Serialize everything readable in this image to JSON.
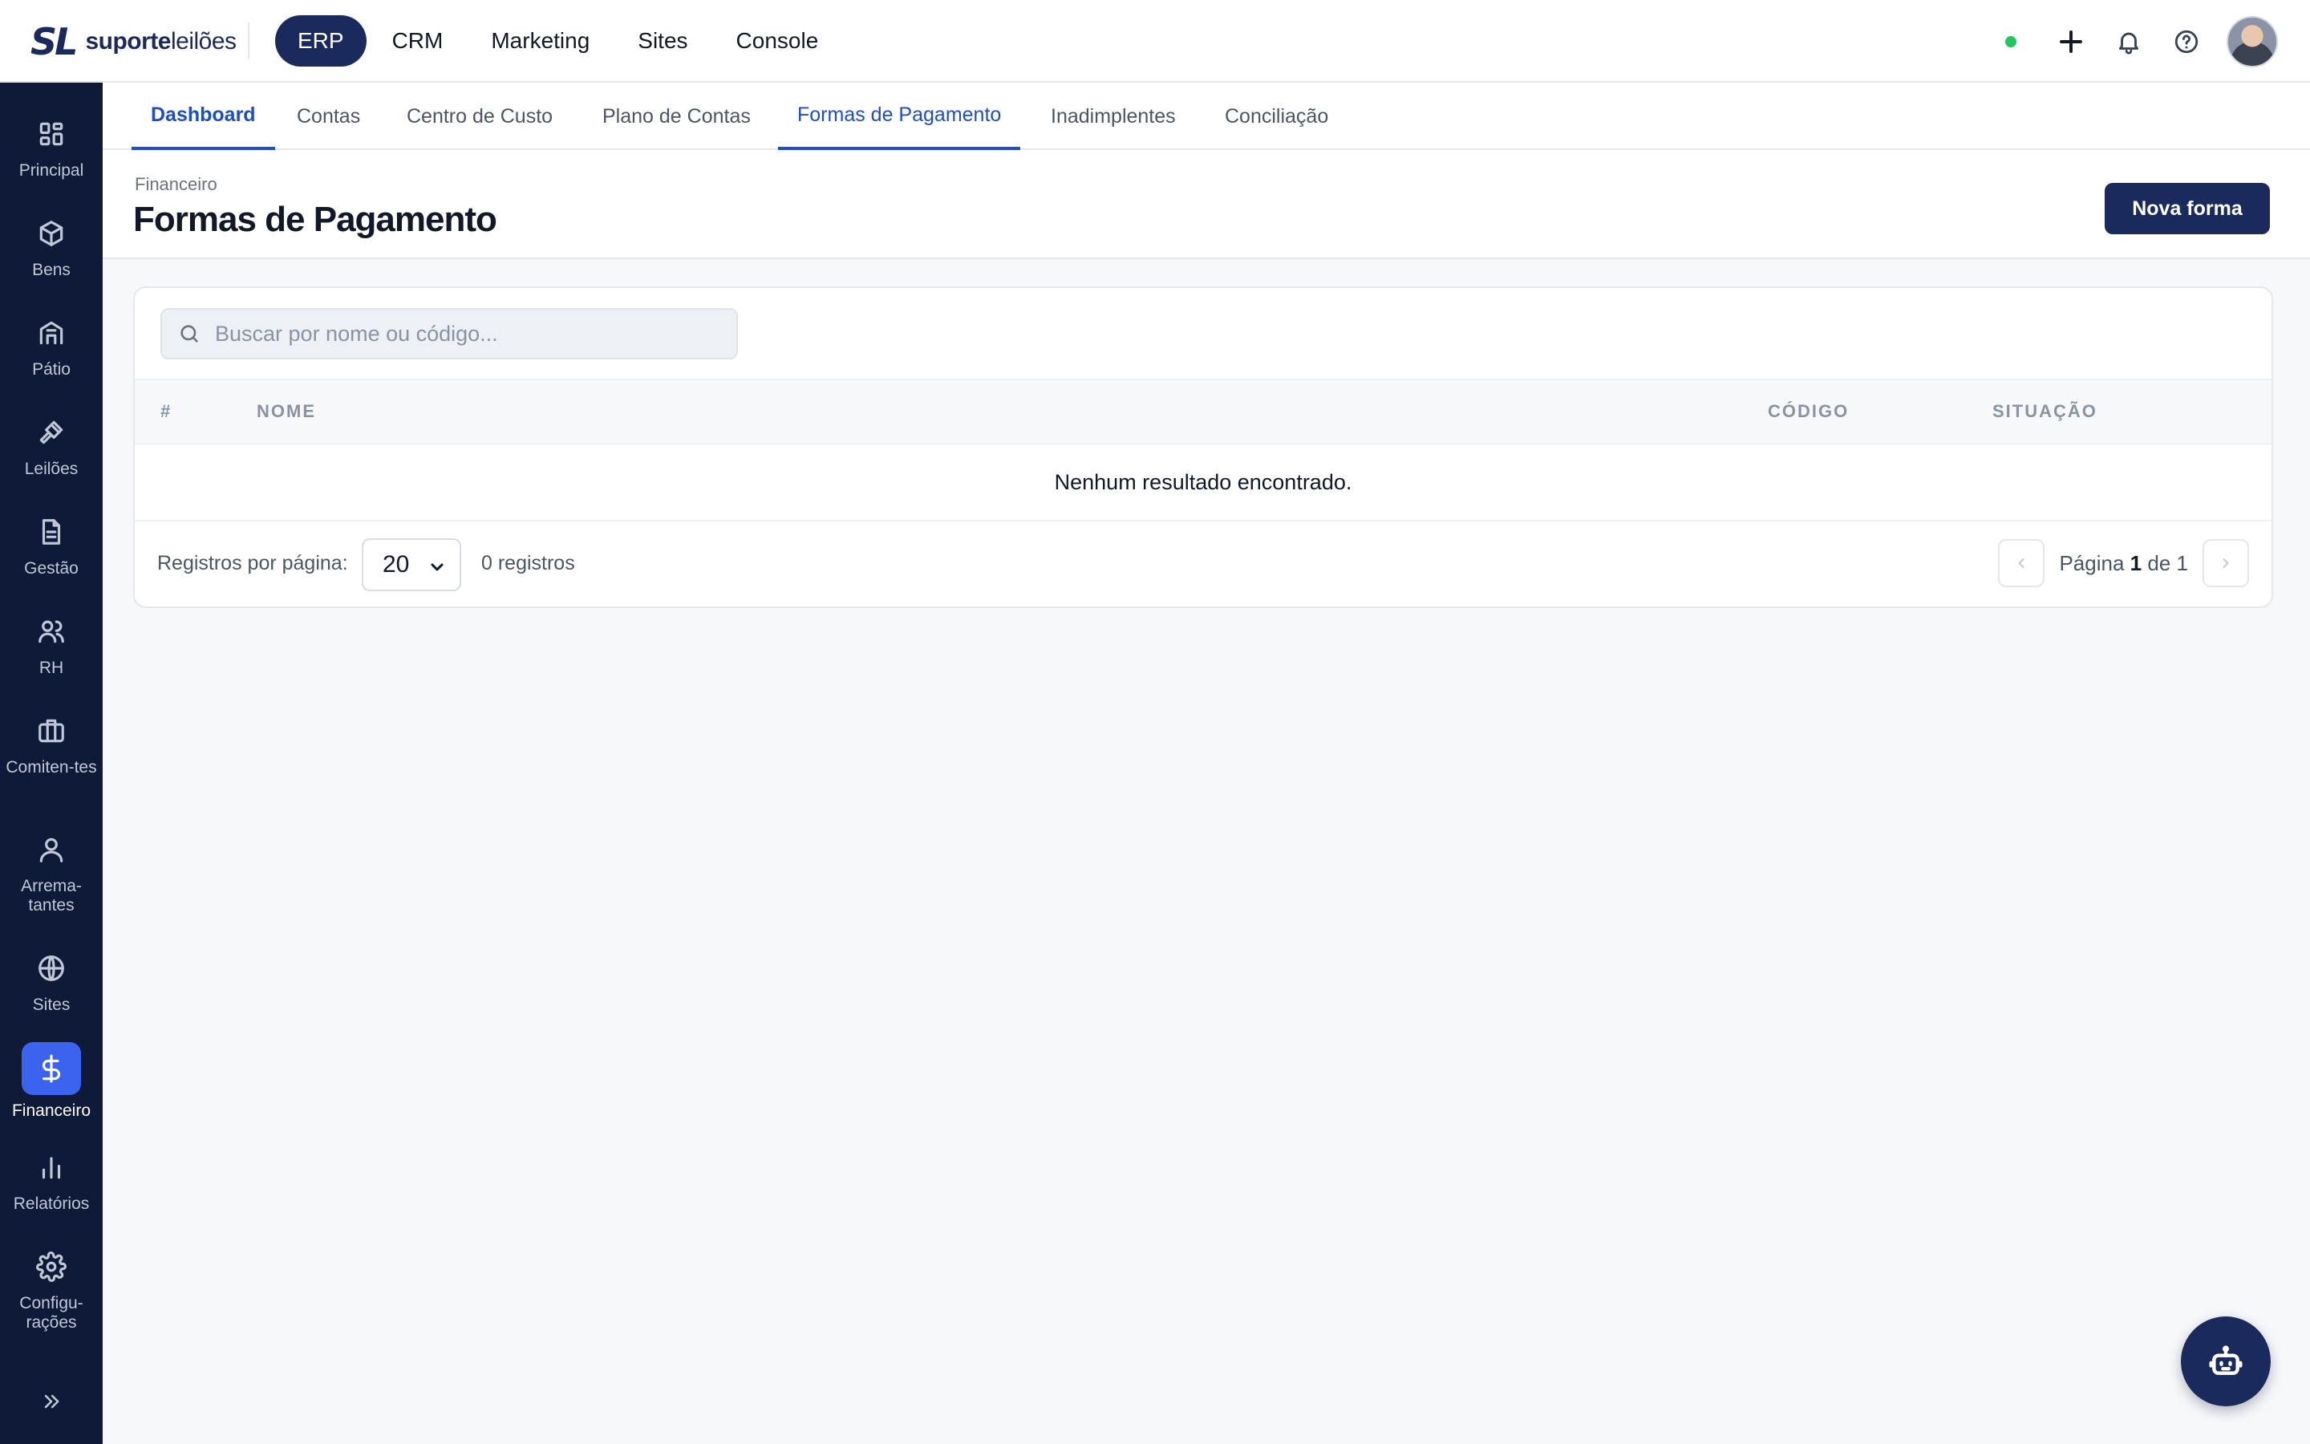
{
  "brand": {
    "mark": "SL",
    "name_bold": "suporte",
    "name_light": "leilões"
  },
  "topnav": [
    {
      "label": "ERP",
      "active": true
    },
    {
      "label": "CRM"
    },
    {
      "label": "Marketing"
    },
    {
      "label": "Sites"
    },
    {
      "label": "Console"
    }
  ],
  "topbar_icons": [
    "status-dot",
    "plus-icon",
    "bell-icon",
    "help-icon",
    "avatar"
  ],
  "sidebar": {
    "items": [
      {
        "label": "Principal",
        "icon": "grid-icon"
      },
      {
        "label": "Bens",
        "icon": "box-icon"
      },
      {
        "label": "Pátio",
        "icon": "warehouse-icon"
      },
      {
        "label": "Leilões",
        "icon": "gavel-icon"
      },
      {
        "label": "Gestão",
        "icon": "document-icon"
      },
      {
        "label": "RH",
        "icon": "users-icon"
      },
      {
        "label": "Comiten-tes",
        "icon": "briefcase-icon"
      },
      {
        "label": "Arrema-tantes",
        "icon": "user-icon"
      },
      {
        "label": "Sites",
        "icon": "globe-icon"
      },
      {
        "label": "Financeiro",
        "icon": "dollar-icon",
        "active": true
      },
      {
        "label": "Relatórios",
        "icon": "bar-chart-icon"
      },
      {
        "label": "Configu-rações",
        "icon": "gear-icon"
      }
    ],
    "collapse_icon": "chevrons-right-icon"
  },
  "tabs": [
    {
      "label": "Dashboard",
      "state": "active"
    },
    {
      "label": "Contas"
    },
    {
      "label": "Centro de Custo"
    },
    {
      "label": "Plano de Contas"
    },
    {
      "label": "Formas de Pagamento",
      "state": "current"
    },
    {
      "label": "Inadimplentes"
    },
    {
      "label": "Conciliação"
    }
  ],
  "page": {
    "breadcrumb": "Financeiro",
    "title": "Formas de Pagamento",
    "new_button": "Nova forma"
  },
  "search": {
    "placeholder": "Buscar por nome ou código...",
    "value": ""
  },
  "table": {
    "columns": [
      "#",
      "NOME",
      "CÓDIGO",
      "SITUAÇÃO"
    ],
    "rows": [],
    "empty_message": "Nenhum resultado encontrado."
  },
  "footer": {
    "per_page_label": "Registros por página:",
    "per_page_value": "20",
    "count": "0 registros",
    "page_word": "Página",
    "page_current": "1",
    "page_of": "de",
    "page_total": "1"
  },
  "colors": {
    "brand_navy": "#1b2a5c",
    "accent_blue": "#1e4fc2",
    "active_sidebar": "#3b63f0",
    "status_green": "#22c55e"
  },
  "fab_icon": "bot-icon"
}
